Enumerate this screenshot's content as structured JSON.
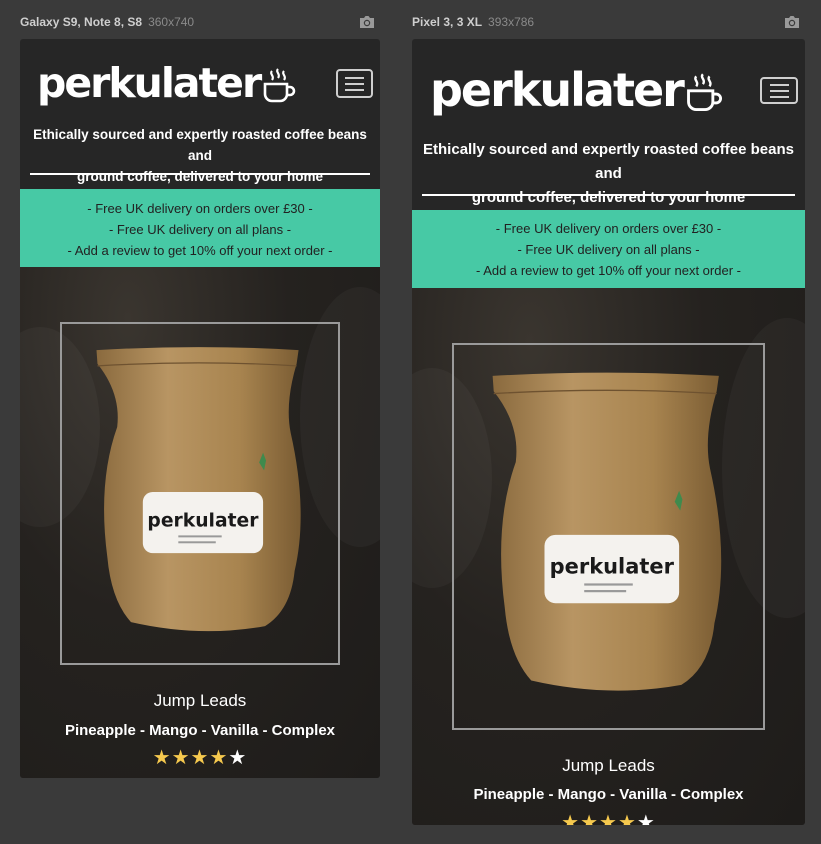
{
  "devices": [
    {
      "name": "Galaxy S9, Note 8, S8",
      "dims": "360x740"
    },
    {
      "name": "Pixel 3, 3 XL",
      "dims": "393x786"
    }
  ],
  "site": {
    "logo_text": "perkulater",
    "tagline_line1": "Ethically sourced and expertly roasted coffee beans and",
    "tagline_line2": "ground coffee, delivered to your home",
    "promo": [
      "- Free UK delivery on orders over £30 -",
      "- Free UK delivery on all plans -",
      "- Add a review to get 10% off your next order -"
    ],
    "product": {
      "name": "Jump Leads",
      "notes": "Pineapple - Mango - Vanilla - Complex",
      "bag_label": "perkulater",
      "rating": 4,
      "rating_max": 5
    }
  },
  "colors": {
    "page_bg": "#3a3a3a",
    "phone_bg": "#262626",
    "promo_bg": "#47c9a5",
    "star_filled": "#f6c94e",
    "star_empty": "#ffffff"
  },
  "icons": [
    "camera-icon",
    "coffee-cup-icon",
    "hamburger-menu-icon",
    "star-icon"
  ]
}
